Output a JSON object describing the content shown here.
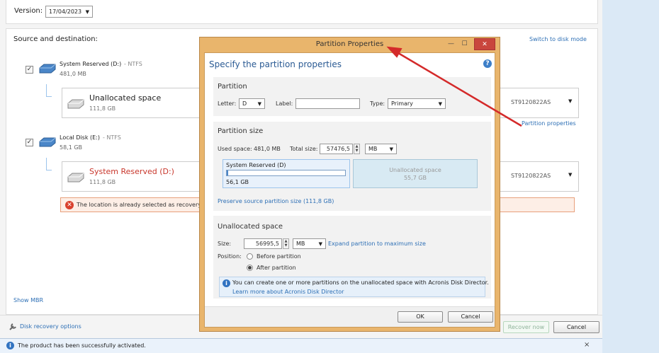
{
  "version": {
    "label": "Version:",
    "value": "17/04/2023"
  },
  "source_dest": {
    "title": "Source and destination:",
    "switch_link": "Switch to disk mode",
    "entries": [
      {
        "name": "System Reserved (D:)",
        "fs": "- NTFS",
        "size": "481,0 MB",
        "dest_name": "Unallocated space",
        "dest_size": "111,8 GB",
        "disk": "ST9120822AS",
        "checked": "✓"
      },
      {
        "name": "Local Disk (E:)",
        "fs": "- NTFS",
        "size": "58,1 GB",
        "dest_name": "System Reserved (D:)",
        "dest_size": "111,8 GB",
        "disk": "ST9120822AS",
        "checked": "✓"
      }
    ],
    "partition_properties_link": "Partition properties",
    "error": "The location is already selected as recovery d",
    "show_mbr": "Show MBR"
  },
  "bottom": {
    "disk_recovery_options": "Disk recovery options",
    "recover_now": "Recover now",
    "cancel": "Cancel"
  },
  "status": {
    "text": "The product has been successfully activated.",
    "close": "×"
  },
  "dialog": {
    "title": "Partition Properties",
    "heading": "Specify the partition properties",
    "partition": {
      "title": "Partition",
      "letter_label": "Letter:",
      "letter_value": "D",
      "label_label": "Label:",
      "label_value": "",
      "type_label": "Type:",
      "type_value": "Primary"
    },
    "size": {
      "title": "Partition size",
      "used_label": "Used space:",
      "used_value": "481,0 MB",
      "total_label": "Total size:",
      "total_value": "57476,5",
      "unit": "MB",
      "bar_label": "System Reserved (D)",
      "bar_value": "56,1 GB",
      "unalloc_label": "Unallocated space",
      "unalloc_value": "55,7 GB",
      "preserve_link": "Preserve source partition size (111,8 GB)"
    },
    "unallocated": {
      "title": "Unallocated space",
      "size_label": "Size:",
      "size_value": "56995,5",
      "unit": "MB",
      "expand_link": "Expand partition to maximum size",
      "position_label": "Position:",
      "before": "Before partition",
      "after": "After partition",
      "info_text": "You can create one or more partitions on the unallocated space with Acronis Disk Director.",
      "info_link": "Learn more about Acronis Disk Director"
    },
    "ok": "OK",
    "cancel": "Cancel",
    "win_min": "—",
    "win_max": "☐",
    "win_close": "✕"
  },
  "colors": {
    "arrow": "#d42a2a",
    "dialog_frame": "#e9b56c",
    "link": "#2d6fb5"
  }
}
